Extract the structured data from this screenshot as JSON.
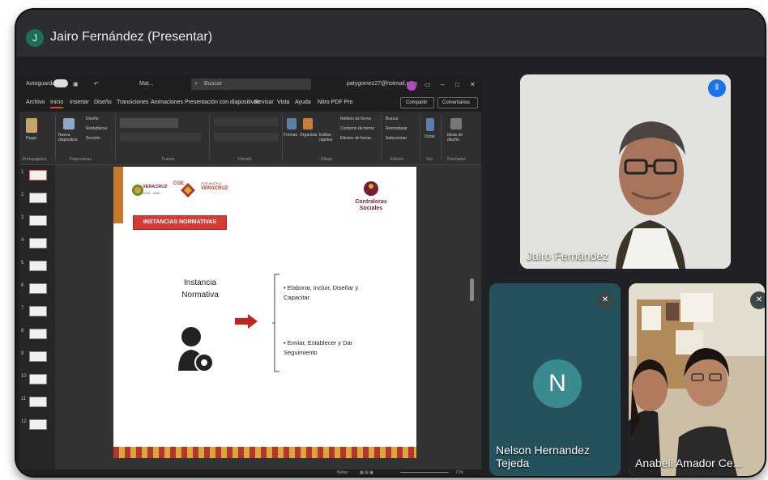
{
  "meeting": {
    "presenter_avatar_letter": "J",
    "title": "Jairo Fernández (Presentar)"
  },
  "powerpoint": {
    "autosave_label": "Autoguardado",
    "doc_name": "Mat...",
    "search_placeholder": "Buscar",
    "user_email": "patygomez27@hotmail.com",
    "menu": [
      "Archivo",
      "Inicio",
      "Insertar",
      "Diseño",
      "Transiciones",
      "Animaciones",
      "Presentación con diapositivas",
      "Revisar",
      "Vista",
      "Ayuda",
      "Nitro PDF Pro"
    ],
    "active_menu": "Inicio",
    "share_label": "Compartir",
    "comments_label": "Comentarios",
    "ribbon_groups": [
      "Portapapeles",
      "Diapositivas",
      "Fuente",
      "Párrafo",
      "Dibujo",
      "Edición",
      "Voz",
      "Diseñador"
    ],
    "ribbon_items": {
      "paste": "Pegar",
      "new_slide": "Nueva diapositiva",
      "layout": "Diseño",
      "reset": "Restablecer",
      "section": "Sección",
      "shapes": "Formas",
      "arrange": "Organizar",
      "quick_styles": "Estilos rápidos",
      "shape_fill": "Relleno de forma",
      "shape_outline": "Contorno de forma",
      "shape_effects": "Efectos de forma",
      "find": "Buscar",
      "replace": "Reemplazar",
      "select": "Seleccionar",
      "dictate": "Dictar",
      "designer_ideas": "Ideas de diseño"
    },
    "thumb_numbers": [
      "1",
      "2",
      "3",
      "4",
      "5",
      "6",
      "7",
      "8",
      "9",
      "10",
      "11",
      "12"
    ],
    "selected_thumb": "1",
    "status_notes": "Notas",
    "zoom": "71%"
  },
  "slide": {
    "logo_text": "VERACRUZ",
    "logo_years": "2024 - 2030",
    "logo2_text": "VERACRUZ",
    "logo2_small": "POR AMOR A",
    "logo_cge": "CGE",
    "cs_title": "Contraloras Sociales",
    "pill": "INSTANCIAS NORMATIVAS",
    "instance_label": "Instancia Normativa",
    "bullets": [
      "• Elaborar, Incluir, Diseñar y Capacitar",
      "• Enviar, Establecer y Dar Seguimiento"
    ]
  },
  "participants": {
    "jairo": "Jairo Fernández",
    "nelson": "Nelson Hernandez Tejeda",
    "nelson_initial": "N",
    "anabell": "Anabell Amador Ce..."
  },
  "colors": {
    "accent_red": "#d63b33",
    "meet_dark": "#202124",
    "mic_blue": "#1a73e8"
  }
}
